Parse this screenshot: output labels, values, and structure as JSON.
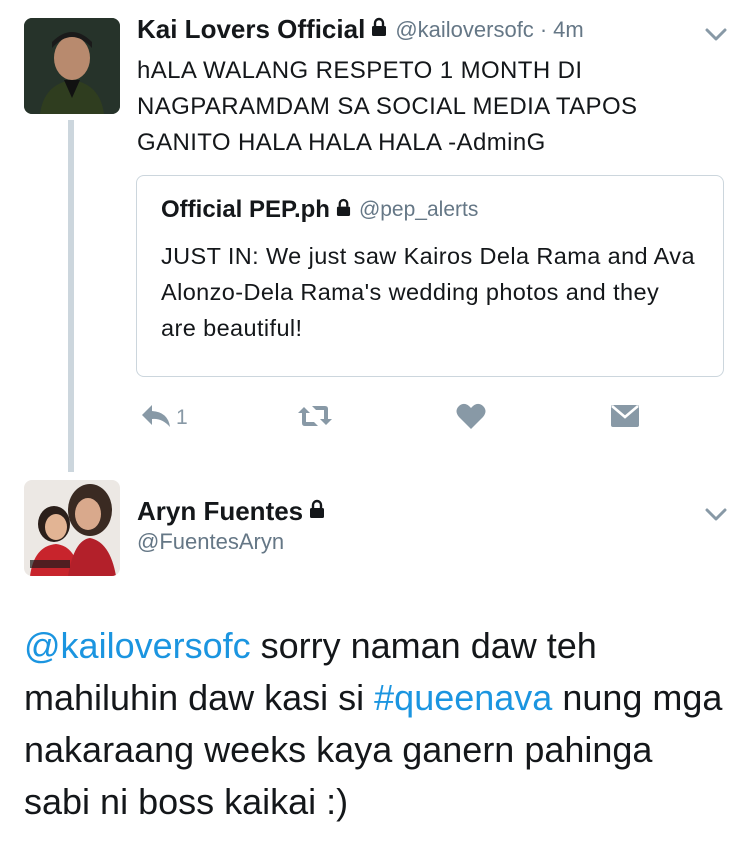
{
  "tweet1": {
    "display_name": "Kai Lovers Official",
    "handle": "@kailoversofc",
    "separator": "·",
    "time": "4m",
    "text": "hALA WALANG RESPETO 1 MONTH DI NAGPARAMDAM SA SOCIAL MEDIA TAPOS GANITO HALA HALA HALA -AdminG"
  },
  "quoted": {
    "display_name": "Official PEP.ph",
    "handle": "@pep_alerts",
    "text": "JUST IN: We just saw Kairos Dela Rama and Ava Alonzo-Dela Rama's wedding photos and they are beautiful!"
  },
  "actions": {
    "reply_count": "1"
  },
  "tweet2": {
    "display_name": "Aryn Fuentes",
    "handle": "@FuentesAryn",
    "text_mention": "@kailoversofc",
    "text_part1": " sorry naman daw teh mahiluhin daw kasi si ",
    "text_hashtag": "#queenava",
    "text_part2": " nung mga nakaraang weeks kaya ganern pahinga sabi ni boss kaikai :)"
  },
  "colors": {
    "link": "#1b95e0",
    "secondary": "#657786",
    "icon": "#8899a6",
    "border": "#ccd6dd"
  },
  "icons": [
    "lock-icon",
    "chevron-down-icon",
    "reply-icon",
    "retweet-icon",
    "heart-icon",
    "direct-message-icon"
  ]
}
